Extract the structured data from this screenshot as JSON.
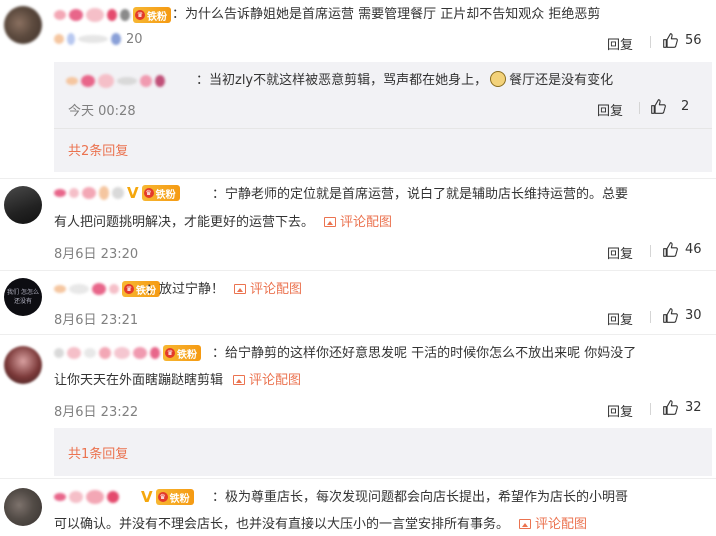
{
  "comments": [
    {
      "badge": "铁粉",
      "text": "：为什么告诉静姐她是首席运营  需要管理餐厅 正片却不告知观众   拒绝恶剪",
      "time_partial": "20",
      "reply": "回复",
      "likes": "56",
      "sub_reply": {
        "text": "：当初zly不就这样被恶意剪辑，骂声都在她身上，",
        "text_after_emoji": "餐厅还是没有变化",
        "time": "今天 00:28",
        "reply": "回复",
        "likes": "2"
      },
      "more_replies": "共2条回复"
    },
    {
      "badge": "铁粉",
      "text_line1": "：宁静老师的定位就是首席运营，说白了就是辅助店长维持运营的。总要",
      "text_line2": "有人把问题挑明解决，才能更好的运营下去。",
      "pic_label": "评论配图",
      "time": "8月6日 23:20",
      "reply": "回复",
      "likes": "46"
    },
    {
      "badge": "铁粉",
      "avatar_text": "我们 怎怎么 还没有",
      "text": "：放过宁静！",
      "pic_label": "评论配图",
      "time": "8月6日 23:21",
      "reply": "回复",
      "likes": "30"
    },
    {
      "badge": "铁粉",
      "text_line1": "：给宁静剪的这样你还好意思发呢 干活的时候你怎么不放出来呢 你妈没了",
      "text_line2": "让你天天在外面瞎蹦跶瞎剪辑",
      "pic_label": "评论配图",
      "time": "8月6日 23:22",
      "reply": "回复",
      "likes": "32",
      "more_replies": "共1条回复"
    },
    {
      "badge": "铁粉",
      "text_line1": "：极为尊重店长，每次发现问题都会向店长提出，希望作为店长的小明哥",
      "text_line2": "可以确认。并没有不理会店长，也并没有直接以大压小的一言堂安排所有事务。",
      "pic_label": "评论配图"
    }
  ],
  "colors": {
    "accent": "#eb7350",
    "badge": "#f5a70d",
    "muted": "#808080",
    "subbox": "#f2f2f5"
  }
}
